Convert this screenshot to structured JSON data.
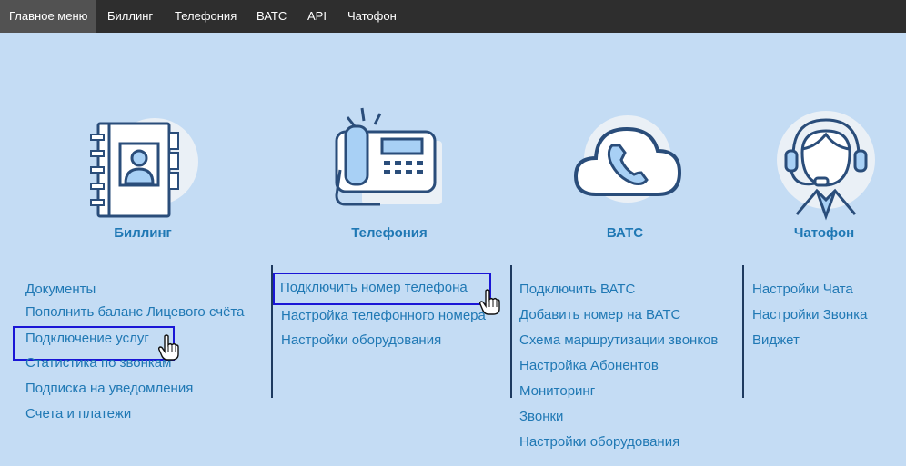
{
  "nav": {
    "tabs": [
      {
        "label": "Главное меню",
        "active": true
      },
      {
        "label": "Биллинг"
      },
      {
        "label": "Телефония"
      },
      {
        "label": "ВАТС"
      },
      {
        "label": "API"
      },
      {
        "label": "Чатофон"
      }
    ]
  },
  "sections": {
    "billing": {
      "title": "Биллинг",
      "links": [
        "Документы",
        "Пополнить баланс Лицевого счёта",
        "Подключение услуг",
        "Статистика по звонкам",
        "Подписка на уведомления",
        "Счета и платежи"
      ],
      "highlighted_index": 2
    },
    "telephony": {
      "title": "Телефония",
      "links": [
        "Подключить номер телефона",
        "Настройка телефонного номера",
        "Настройки оборудования"
      ],
      "highlighted_index": 0
    },
    "vats": {
      "title": "ВАТС",
      "links": [
        "Подключить ВАТС",
        "Добавить номер на ВАТС",
        "Схема маршрутизации звонков",
        "Настройка Абонентов",
        "Мониторинг",
        "Звонки",
        "Настройки оборудования"
      ]
    },
    "chatofon": {
      "title": "Чатофон",
      "links": [
        "Настройки Чата",
        "Настройки Звонка",
        "Виджет"
      ]
    }
  },
  "icons": {
    "billing": "address-book-icon",
    "telephony": "desk-phone-icon",
    "vats": "cloud-phone-icon",
    "chatofon": "support-operator-icon"
  },
  "colors": {
    "background": "#c4dcf4",
    "topbar": "#2e2e2e",
    "active_tab": "#525252",
    "link": "#1f78b4",
    "icon_stroke": "#2a4d7a",
    "icon_fill": "#a8d0f5",
    "highlight_box": "#1a16d6"
  }
}
